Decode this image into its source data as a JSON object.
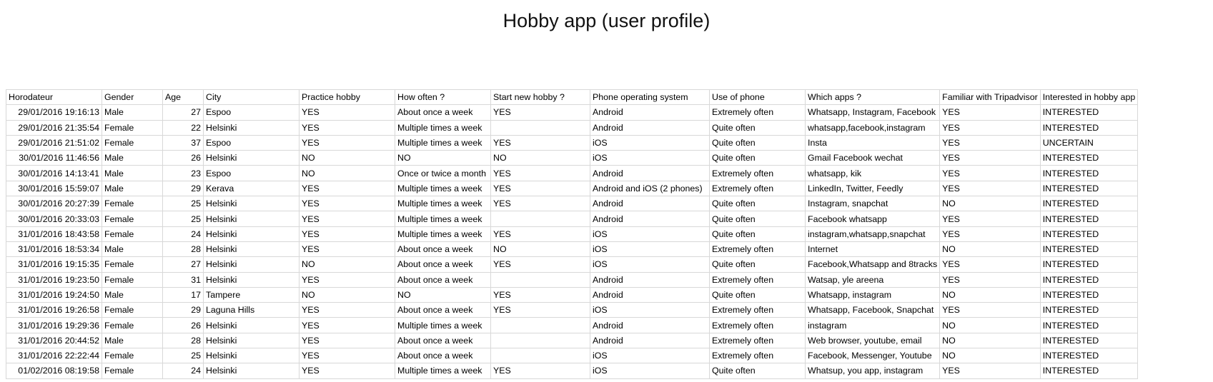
{
  "title": "Hobby app (user profile)",
  "columns": [
    "Horodateur",
    "Gender",
    "Age",
    "City",
    "Practice hobby",
    "How often ?",
    "Start new hobby ?",
    "Phone operating system",
    "Use of phone",
    "Which apps ?",
    "Familiar with Tripadvisor",
    "Interested in hobby app"
  ],
  "rows": [
    [
      "29/01/2016 19:16:13",
      "Male",
      "27",
      "Espoo",
      "YES",
      "About once a week",
      "YES",
      "Android",
      "Extremely often",
      "Whatsapp, Instagram, Facebook",
      "YES",
      "INTERESTED"
    ],
    [
      "29/01/2016 21:35:54",
      "Female",
      "22",
      "Helsinki",
      "YES",
      "Multiple times a week",
      "",
      "Android",
      "Quite often",
      "whatsapp,facebook,instagram",
      "YES",
      "INTERESTED"
    ],
    [
      "29/01/2016 21:51:02",
      "Female",
      "37",
      "Espoo",
      "YES",
      "Multiple times a week",
      "YES",
      "iOS",
      "Quite often",
      "Insta",
      "YES",
      "UNCERTAIN"
    ],
    [
      "30/01/2016 11:46:56",
      "Male",
      "26",
      "Helsinki",
      "NO",
      "NO",
      "NO",
      "iOS",
      "Quite often",
      "Gmail Facebook wechat",
      "YES",
      "INTERESTED"
    ],
    [
      "30/01/2016 14:13:41",
      "Male",
      "23",
      "Espoo",
      "NO",
      "Once or twice a month",
      "YES",
      "Android",
      "Extremely often",
      "whatsapp, kik",
      "YES",
      "INTERESTED"
    ],
    [
      "30/01/2016 15:59:07",
      "Male",
      "29",
      "Kerava",
      "YES",
      "Multiple times a week",
      "YES",
      "Android and iOS (2 phones)",
      "Extremely often",
      "LinkedIn, Twitter, Feedly",
      "YES",
      "INTERESTED"
    ],
    [
      "30/01/2016 20:27:39",
      "Female",
      "25",
      "Helsinki",
      "YES",
      "Multiple times a week",
      "YES",
      "Android",
      "Quite often",
      "Instagram, snapchat",
      "NO",
      "INTERESTED"
    ],
    [
      "30/01/2016 20:33:03",
      "Female",
      "25",
      "Helsinki",
      "YES",
      "Multiple times a week",
      "",
      "Android",
      "Quite often",
      "Facebook whatsapp",
      "YES",
      "INTERESTED"
    ],
    [
      "31/01/2016 18:43:58",
      "Female",
      "24",
      "Helsinki",
      "YES",
      "Multiple times a week",
      "YES",
      "iOS",
      "Quite often",
      "instagram,whatsapp,snapchat",
      "YES",
      "INTERESTED"
    ],
    [
      "31/01/2016 18:53:34",
      "Male",
      "28",
      "Helsinki",
      "YES",
      "About once a week",
      "NO",
      "iOS",
      "Extremely often",
      "Internet",
      "NO",
      "INTERESTED"
    ],
    [
      "31/01/2016 19:15:35",
      "Female",
      "27",
      "Helsinki",
      "NO",
      "About once a week",
      "YES",
      "iOS",
      "Quite often",
      "Facebook,Whatsapp and 8tracks",
      "YES",
      "INTERESTED"
    ],
    [
      "31/01/2016 19:23:50",
      "Female",
      "31",
      "Helsinki",
      "YES",
      "About once a week",
      "",
      "Android",
      "Extremely often",
      "Watsap, yle areena",
      "YES",
      "INTERESTED"
    ],
    [
      "31/01/2016 19:24:50",
      "Male",
      "17",
      "Tampere",
      "NO",
      "NO",
      "YES",
      "Android",
      "Quite often",
      "Whatsapp, instagram",
      "NO",
      "INTERESTED"
    ],
    [
      "31/01/2016 19:26:58",
      "Female",
      "29",
      "Laguna Hills",
      "YES",
      "About once a week",
      "YES",
      "iOS",
      "Extremely often",
      "Whatsapp, Facebook, Snapchat",
      "YES",
      "INTERESTED"
    ],
    [
      "31/01/2016 19:29:36",
      "Female",
      "26",
      "Helsinki",
      "YES",
      "Multiple times a week",
      "",
      "Android",
      "Extremely often",
      "instagram",
      "NO",
      "INTERESTED"
    ],
    [
      "31/01/2016 20:44:52",
      "Male",
      "28",
      "Helsinki",
      "YES",
      "About once a week",
      "",
      "Android",
      "Extremely often",
      "Web browser, youtube, email",
      "NO",
      "INTERESTED"
    ],
    [
      "31/01/2016 22:22:44",
      "Female",
      "25",
      "Helsinki",
      "YES",
      "About once a week",
      "",
      "iOS",
      "Extremely often",
      "Facebook, Messenger, Youtube",
      "NO",
      "INTERESTED"
    ],
    [
      "01/02/2016 08:19:58",
      "Female",
      "24",
      "Helsinki",
      "YES",
      "Multiple times a week",
      "YES",
      "iOS",
      "Quite often",
      "Whatsup, you app, instagram",
      "YES",
      "INTERESTED"
    ]
  ]
}
